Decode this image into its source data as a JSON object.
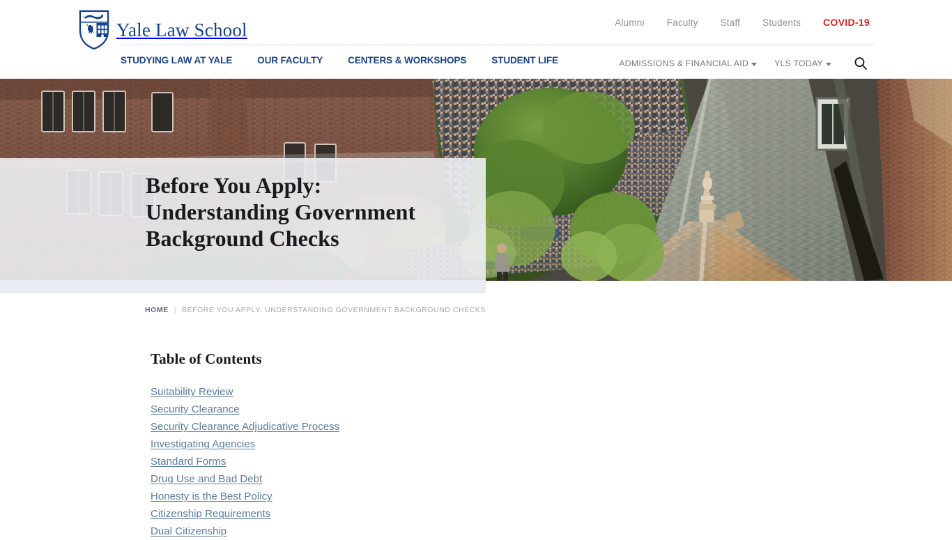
{
  "site": {
    "logo_icon": "yale-shield-crest-icon",
    "wordmark": "Yale Law School"
  },
  "utility_nav": {
    "items": [
      {
        "label": "Alumni",
        "style": "default"
      },
      {
        "label": "Faculty",
        "style": "default"
      },
      {
        "label": "Staff",
        "style": "default"
      },
      {
        "label": "Students",
        "style": "default"
      },
      {
        "label": "COVID-19",
        "style": "alert"
      }
    ],
    "alert_color": "#e02020"
  },
  "primary_nav": {
    "accent_color": "#1c4587",
    "items": [
      {
        "label": "STUDYING LAW AT YALE"
      },
      {
        "label": "OUR FACULTY"
      },
      {
        "label": "CENTERS & WORKSHOPS"
      },
      {
        "label": "STUDENT LIFE"
      }
    ],
    "right_items": [
      {
        "label": "ADMISSIONS & FINANCIAL AID",
        "has_caret": true
      },
      {
        "label": "YLS TODAY",
        "has_caret": true
      }
    ],
    "search_icon": "search-icon"
  },
  "hero": {
    "title": "Before You Apply:\nUnderstanding Government\nBackground Checks",
    "panel_color": "#eef0f4",
    "image_description": "Aerial view of Yale Law School courtyard with slate-tiled turret and crowd"
  },
  "breadcrumb": {
    "home_label": "HOME",
    "separator": "|",
    "current_label": "BEFORE YOU APPLY: UNDERSTANDING GOVERNMENT BACKGROUND CHECKS"
  },
  "main": {
    "toc_heading": "Table of Contents",
    "toc_items": [
      {
        "label": "Suitability Review"
      },
      {
        "label": "Security Clearance"
      },
      {
        "label": "Security Clearance Adjudicative Process"
      },
      {
        "label": "Investigating Agencies"
      },
      {
        "label": "Standard Forms"
      },
      {
        "label": "Drug Use and Bad Debt"
      },
      {
        "label": "Honesty is the Best Policy"
      },
      {
        "label": "Citizenship Requirements"
      },
      {
        "label": "Dual Citizenship"
      }
    ],
    "link_color": "#5b7ba0"
  }
}
